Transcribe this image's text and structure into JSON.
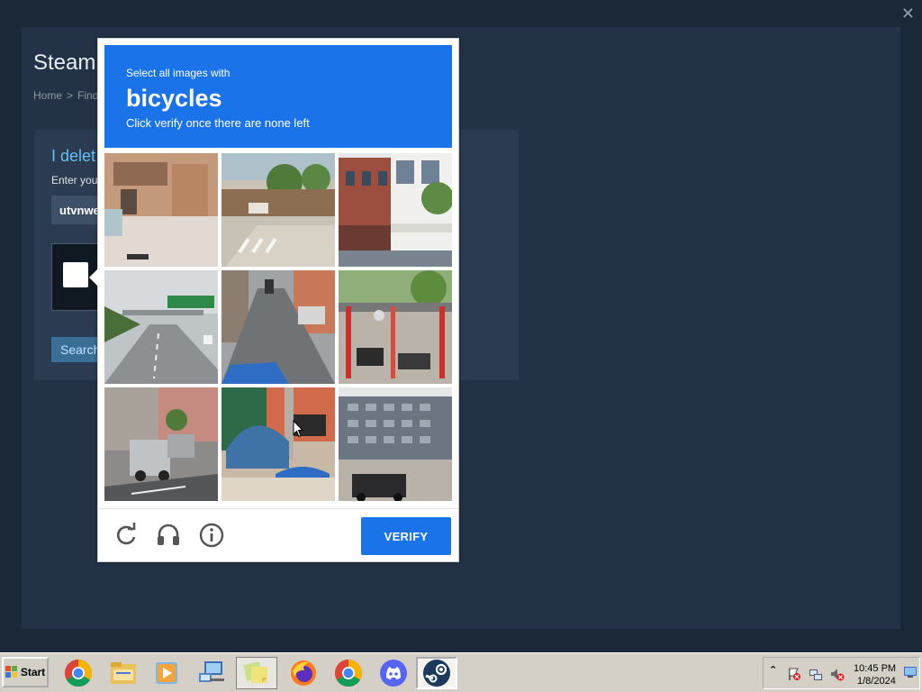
{
  "steam": {
    "title": "Steam",
    "breadcrumb": [
      "Home",
      ">",
      "Find"
    ],
    "heading": "I delet",
    "label": "Enter you",
    "input_value": "utvnwe",
    "search_label": "Search",
    "close_glyph": "✕"
  },
  "captcha": {
    "line1": "Select all images with",
    "target": "bicycles",
    "line3": "Click verify once there are none left",
    "verify_label": "VERIFY",
    "accent_color": "#1a73e8",
    "tiles": [
      "building-street-tile",
      "roadwork-tile",
      "shopfront-tile",
      "highway-tile",
      "narrow-street-tile",
      "scooters-tile",
      "parked-cars-tile",
      "tarp-motorbike-tile",
      "office-building-tile"
    ],
    "icons": [
      "reload-icon",
      "audio-icon",
      "info-icon"
    ]
  },
  "taskbar": {
    "start_label": "Start",
    "apps": [
      "chrome-icon",
      "file-explorer-icon",
      "media-player-icon",
      "network-icon",
      "sticky-notes-icon",
      "firefox-icon",
      "chrome-icon",
      "discord-icon",
      "steam-icon"
    ],
    "tray_arrow": "⌃",
    "time": "10:45 PM",
    "date": "1/8/2024"
  }
}
